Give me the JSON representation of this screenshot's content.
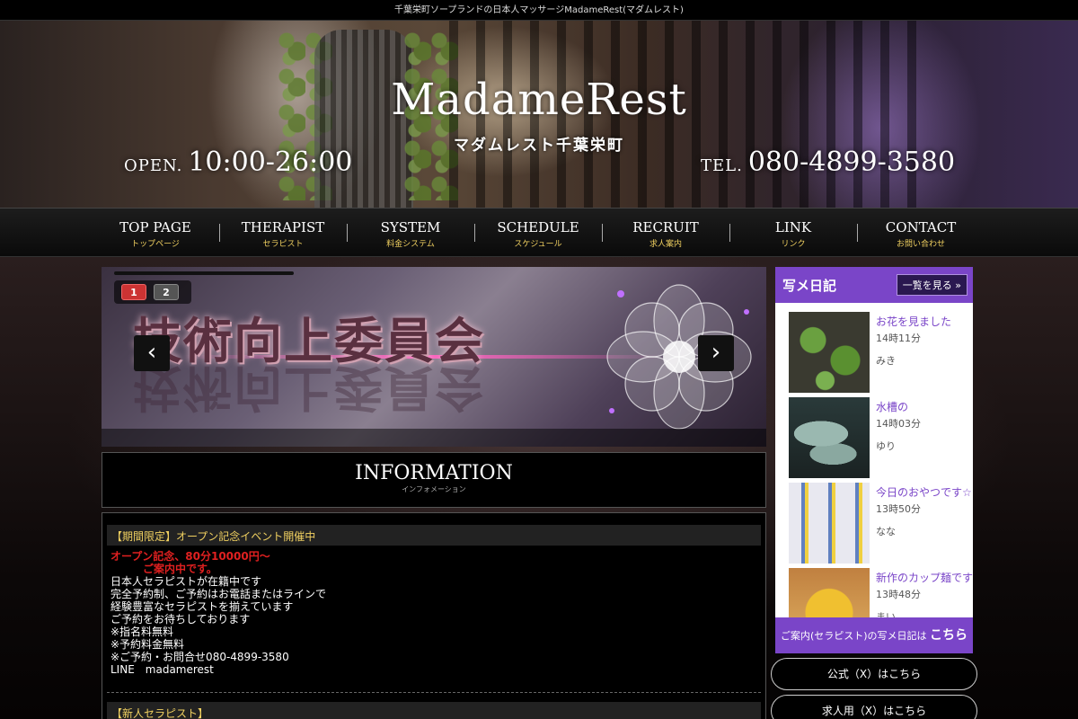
{
  "topbar": {
    "text": "千葉栄町ソープランドの日本人マッサージMadameRest(マダムレスト)"
  },
  "header": {
    "brand": "MadameRest",
    "brand_sub": "マダムレスト千葉栄町",
    "open_label": "OPEN.",
    "open_hours": "10:00-26:00",
    "tel_label": "TEL.",
    "tel_number": "080-4899-3580"
  },
  "nav": [
    {
      "en": "TOP PAGE",
      "ja": "トップページ"
    },
    {
      "en": "THERAPIST",
      "ja": "セラピスト"
    },
    {
      "en": "SYSTEM",
      "ja": "料金システム"
    },
    {
      "en": "SCHEDULE",
      "ja": "スケジュール"
    },
    {
      "en": "RECRUIT",
      "ja": "求人案内"
    },
    {
      "en": "LINK",
      "ja": "リンク"
    },
    {
      "en": "CONTACT",
      "ja": "お問い合わせ"
    }
  ],
  "slider": {
    "pages": [
      "1",
      "2"
    ],
    "active_page": "1",
    "headline": "技術向上委員会",
    "prev_icon": "‹",
    "next_icon": "›"
  },
  "info": {
    "title": "INFORMATION",
    "subtitle": "インフォメーション"
  },
  "news": {
    "item1_title": "【期間限定】オープン記念イベント開催中",
    "item1_red1": "オープン記念、80分10000円～",
    "item1_red2": "ご案内中です。",
    "item1_lines": [
      "日本人セラピストが在籍中です",
      "完全予約制、ご予約はお電話またはラインで",
      "経験豊富なセラピストを揃えています",
      "ご予約をお待ちしております",
      "※指名料無料",
      "※予約料金無料",
      "※ご予約・お問合せ080-4899-3580",
      "LINE　madamerest"
    ],
    "item2_title": "【新人セラピスト】"
  },
  "sidebar": {
    "title": "写メ日記",
    "more": "一覧を見る »",
    "items": [
      {
        "title": "お花を見ました",
        "time": "14時11分",
        "name": "みき"
      },
      {
        "title": "水槽の",
        "time": "14時03分",
        "name": "ゆり"
      },
      {
        "title": "今日のおやつです☆",
        "time": "13時50分",
        "name": "なな"
      },
      {
        "title": "新作のカップ麺です",
        "time": "13時48分",
        "name": "まい"
      }
    ],
    "footer_small": "ご案内(セラピスト)の写メ日記は",
    "footer_big": "こちらからご覧下さい"
  },
  "buttons": {
    "x_official": "公式（X）はこちら",
    "x_recruit": "求人用（X）はこちら"
  },
  "colors": {
    "accent_purple": "#7a45c8",
    "gold": "#f0d060",
    "red": "#e02020"
  }
}
